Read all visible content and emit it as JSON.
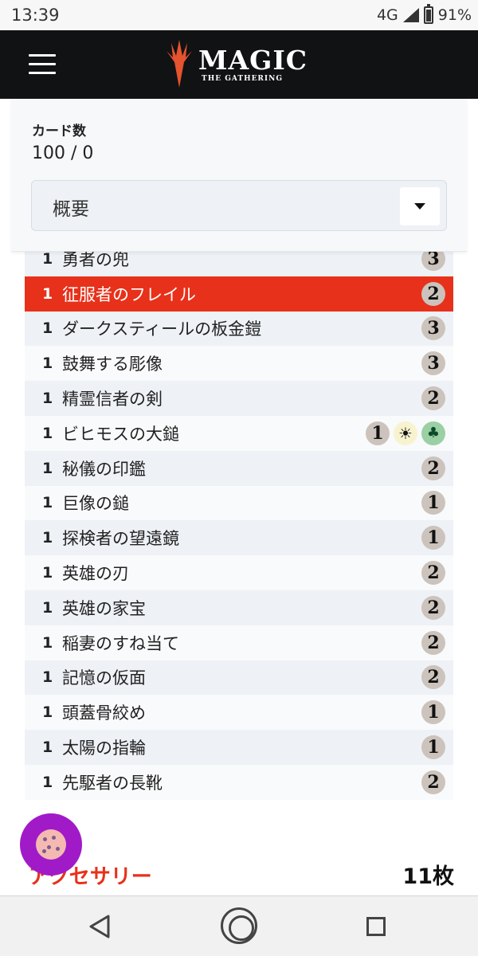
{
  "status_bar": {
    "time": "13:39",
    "network": "4G",
    "battery": "91%"
  },
  "header": {
    "menu_icon": "hamburger-icon",
    "logo_title": "MAGIC",
    "logo_subtitle": "THE GATHERING"
  },
  "summary": {
    "card_count_label": "カード数",
    "card_count_value": "100 / 0",
    "view_select": {
      "selected": "概要"
    }
  },
  "cards": [
    {
      "qty": "1",
      "name": "勇者の兜",
      "mana": [
        "3"
      ]
    },
    {
      "qty": "1",
      "name": "征服者のフレイル",
      "mana": [
        "2"
      ],
      "selected": true
    },
    {
      "qty": "1",
      "name": "ダークスティールの板金鎧",
      "mana": [
        "3"
      ]
    },
    {
      "qty": "1",
      "name": "鼓舞する彫像",
      "mana": [
        "3"
      ]
    },
    {
      "qty": "1",
      "name": "精霊信者の剣",
      "mana": [
        "2"
      ]
    },
    {
      "qty": "1",
      "name": "ビヒモスの大鎚",
      "mana": [
        "1",
        "W",
        "G"
      ]
    },
    {
      "qty": "1",
      "name": "秘儀の印鑑",
      "mana": [
        "2"
      ]
    },
    {
      "qty": "1",
      "name": "巨像の鎚",
      "mana": [
        "1"
      ]
    },
    {
      "qty": "1",
      "name": "探検者の望遠鏡",
      "mana": [
        "1"
      ]
    },
    {
      "qty": "1",
      "name": "英雄の刃",
      "mana": [
        "2"
      ]
    },
    {
      "qty": "1",
      "name": "英雄の家宝",
      "mana": [
        "2"
      ]
    },
    {
      "qty": "1",
      "name": "稲妻のすね当て",
      "mana": [
        "2"
      ]
    },
    {
      "qty": "1",
      "name": "記憶の仮面",
      "mana": [
        "2"
      ]
    },
    {
      "qty": "1",
      "name": "頭蓋骨絞め",
      "mana": [
        "1"
      ]
    },
    {
      "qty": "1",
      "name": "太陽の指輪",
      "mana": [
        "1"
      ]
    },
    {
      "qty": "1",
      "name": "先駆者の長靴",
      "mana": [
        "2"
      ]
    }
  ],
  "section": {
    "title": "アクセサリー",
    "count": "11枚"
  },
  "colors": {
    "accent": "#e8311a",
    "header_bg": "#111214",
    "fab": "#a11ac8"
  }
}
